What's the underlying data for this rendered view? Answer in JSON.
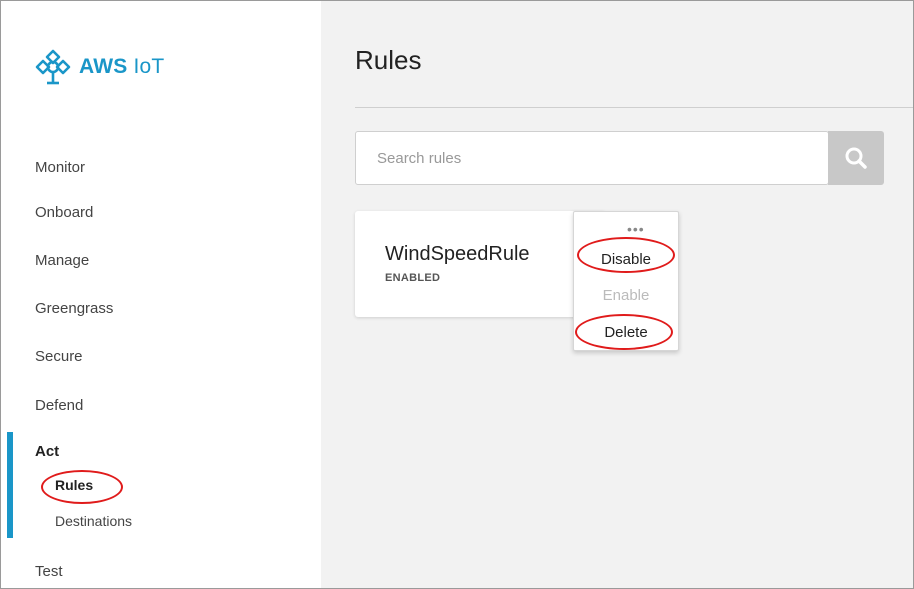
{
  "app": {
    "brand_bold": "AWS",
    "brand_light": "IoT",
    "logo_icon": "aws-iot-logo-icon"
  },
  "sidebar": {
    "items": [
      {
        "label": "Monitor"
      },
      {
        "label": "Onboard"
      },
      {
        "label": "Manage"
      },
      {
        "label": "Greengrass"
      },
      {
        "label": "Secure"
      },
      {
        "label": "Defend"
      },
      {
        "label": "Act"
      },
      {
        "label": "Test"
      }
    ],
    "act_sub": [
      {
        "label": "Rules"
      },
      {
        "label": "Destinations"
      }
    ]
  },
  "main": {
    "title": "Rules",
    "search": {
      "placeholder": "Search rules",
      "icon": "search-icon"
    },
    "rule_card": {
      "name": "WindSpeedRule",
      "status": "ENABLED"
    },
    "context_menu": {
      "dots": "•••",
      "items": [
        {
          "label": "Disable",
          "enabled": true
        },
        {
          "label": "Enable",
          "enabled": false
        },
        {
          "label": "Delete",
          "enabled": true
        }
      ]
    }
  },
  "colors": {
    "accent": "#1a96c8",
    "annotation": "#e01b1b",
    "main_bg": "#f2f2f2"
  }
}
